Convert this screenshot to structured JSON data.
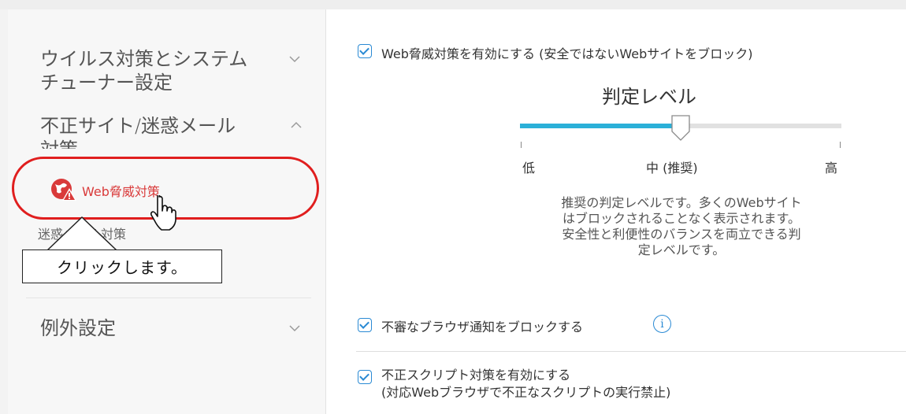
{
  "sidebar": {
    "sections": [
      {
        "label_line1": "ウイルス対策とシステム",
        "label_line2": "チューナー設定",
        "chevron": "chevron-down-icon"
      },
      {
        "label_line1": "不正サイト/迷惑メール",
        "label_line2": "対策",
        "chevron": "chevron-up-icon"
      },
      {
        "label_line1": "例外設定",
        "chevron": "chevron-down-icon"
      }
    ],
    "subitems": [
      {
        "label": "Web脅威対策",
        "icon": "globe-warning-icon",
        "color": "#d93a3a"
      },
      {
        "label": "迷惑メール対策"
      }
    ]
  },
  "annotation": {
    "callout_text": "クリックします。",
    "highlight_color": "#e01e1e"
  },
  "settings": {
    "web_threat": {
      "checked": true,
      "label": "Web脅威対策を有効にする (安全ではないWebサイトをブロック)"
    },
    "level": {
      "title": "判定レベル",
      "low": "低",
      "mid": "中 (推奨)",
      "high": "高",
      "value_percent": 50,
      "fill_color": "#2bb0d8",
      "description_lines": [
        "推奨の判定レベルです。多くのWebサイト",
        "はブロックされることなく表示されます。",
        "安全性と利便性のバランスを両立できる判",
        "定レベルです。"
      ]
    },
    "browser_notify": {
      "checked": true,
      "label": "不審なブラウザ通知をブロックする",
      "info_icon": "i"
    },
    "script": {
      "checked": true,
      "label_line1": "不正スクリプト対策を有効にする",
      "label_line2": "(対応Webブラウザで不正なスクリプトの実行禁止)"
    }
  },
  "colors": {
    "accent_blue": "#2a8ad4",
    "sidebar_bg": "#f7f7f7"
  }
}
